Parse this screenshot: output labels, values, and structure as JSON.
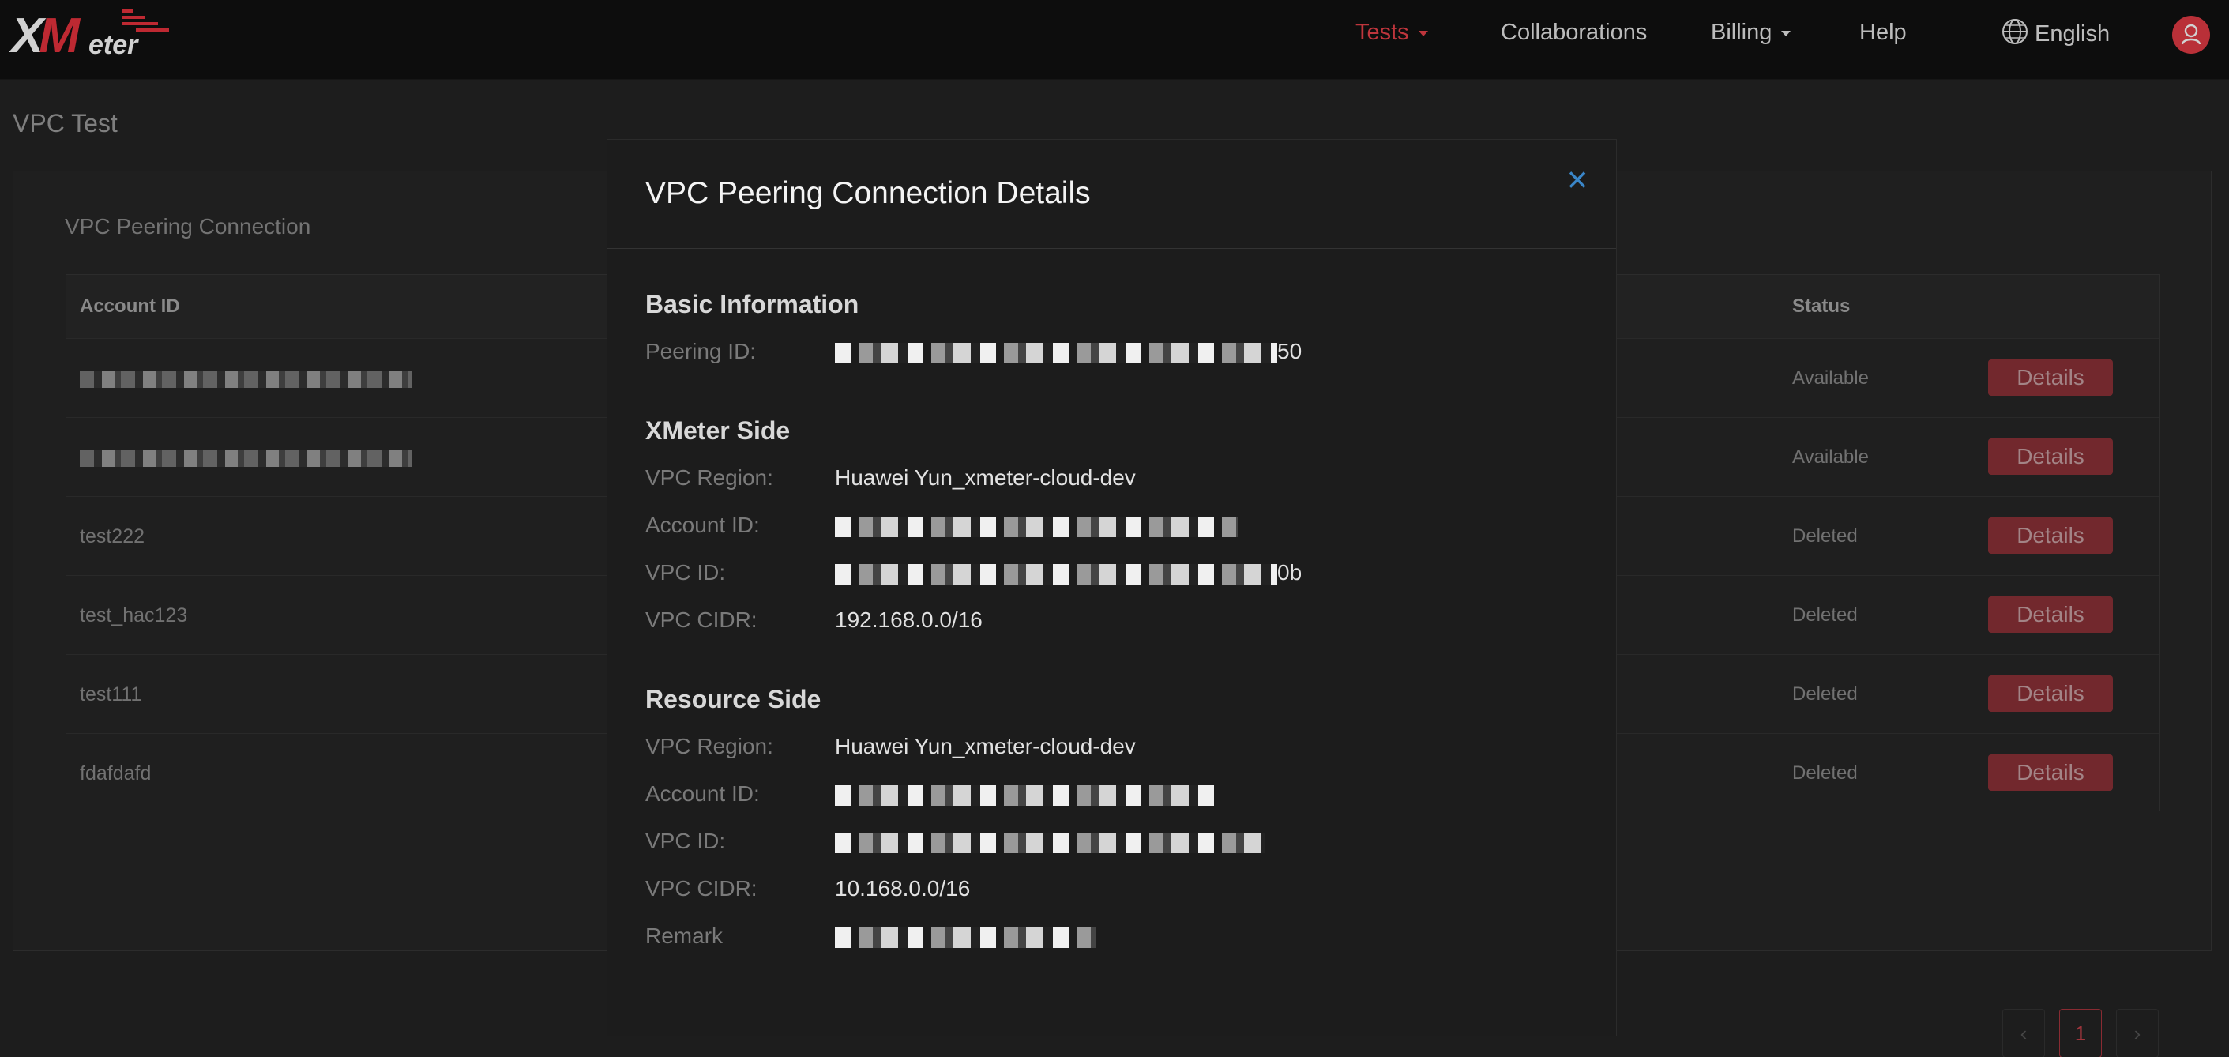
{
  "brand": {
    "logo_text": "XMeter"
  },
  "nav": {
    "tests": "Tests",
    "collaborations": "Collaborations",
    "billing": "Billing",
    "help": "Help",
    "language": "English"
  },
  "page": {
    "title": "VPC Test",
    "card_title": "VPC Peering Connection",
    "columns": {
      "account_id": "Account ID",
      "status": "Status"
    },
    "rows": [
      {
        "account_id": "",
        "status": "Available",
        "action": "Details"
      },
      {
        "account_id": "",
        "status": "Available",
        "action": "Details"
      },
      {
        "account_id": "test222",
        "status": "Deleted",
        "action": "Details"
      },
      {
        "account_id": "test_hac123",
        "status": "Deleted",
        "action": "Details"
      },
      {
        "account_id": "test111",
        "status": "Deleted",
        "action": "Details"
      },
      {
        "account_id": "fdafdafd",
        "status": "Deleted",
        "action": "Details"
      }
    ],
    "pagination": {
      "prev": "‹",
      "current": "1",
      "next": "›"
    }
  },
  "modal": {
    "title": "VPC Peering Connection Details",
    "close": "×",
    "basic": {
      "heading": "Basic Information",
      "peering_id_label": "Peering ID:",
      "peering_id_suffix": "50"
    },
    "xmeter": {
      "heading": "XMeter Side",
      "region_label": "VPC Region:",
      "region": "Huawei Yun_xmeter-cloud-dev",
      "account_label": "Account ID:",
      "vpc_id_label": "VPC ID:",
      "vpc_id_suffix": "0b",
      "cidr_label": "VPC CIDR:",
      "cidr": "192.168.0.0/16"
    },
    "resource": {
      "heading": "Resource Side",
      "region_label": "VPC Region:",
      "region": "Huawei Yun_xmeter-cloud-dev",
      "account_label": "Account ID:",
      "vpc_id_label": "VPC ID:",
      "cidr_label": "VPC CIDR:",
      "cidr": "10.168.0.0/16",
      "remark_label": "Remark"
    }
  }
}
